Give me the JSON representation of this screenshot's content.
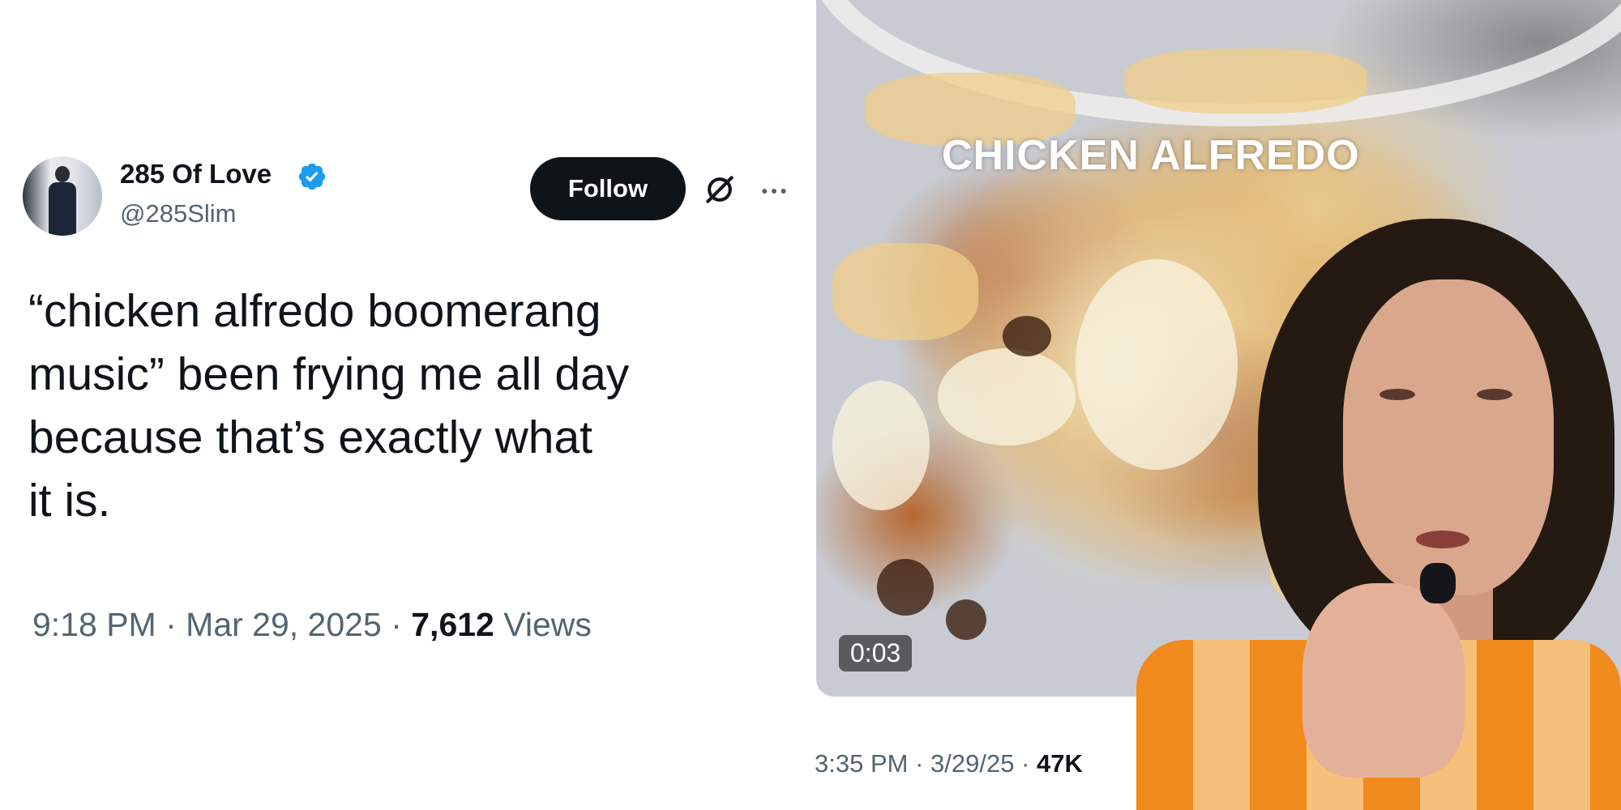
{
  "tweet": {
    "author": {
      "display_name": "285 Of Love",
      "handle": "@285Slim",
      "verified": true
    },
    "follow_label": "Follow",
    "text_lines": [
      "“chicken alfredo boomerang",
      "music” been frying me all day",
      "because that’s exactly what",
      "it is."
    ],
    "time": "9:18 PM",
    "separator": "·",
    "date": "Mar 29, 2025",
    "views_count": "7,612",
    "views_label": "Views"
  },
  "video_post": {
    "caption": "CHICKEN ALFREDO",
    "timestamp": "0:03",
    "time": "3:35 PM",
    "separator": "·",
    "date": "3/29/25",
    "views_count": "47K"
  },
  "colors": {
    "text_primary": "#0f1419",
    "text_secondary": "#536471",
    "verified_blue": "#1d9bf0",
    "follow_bg": "#0f1419"
  },
  "icons": [
    "verified-badge-icon",
    "grok-icon",
    "more-icon"
  ]
}
